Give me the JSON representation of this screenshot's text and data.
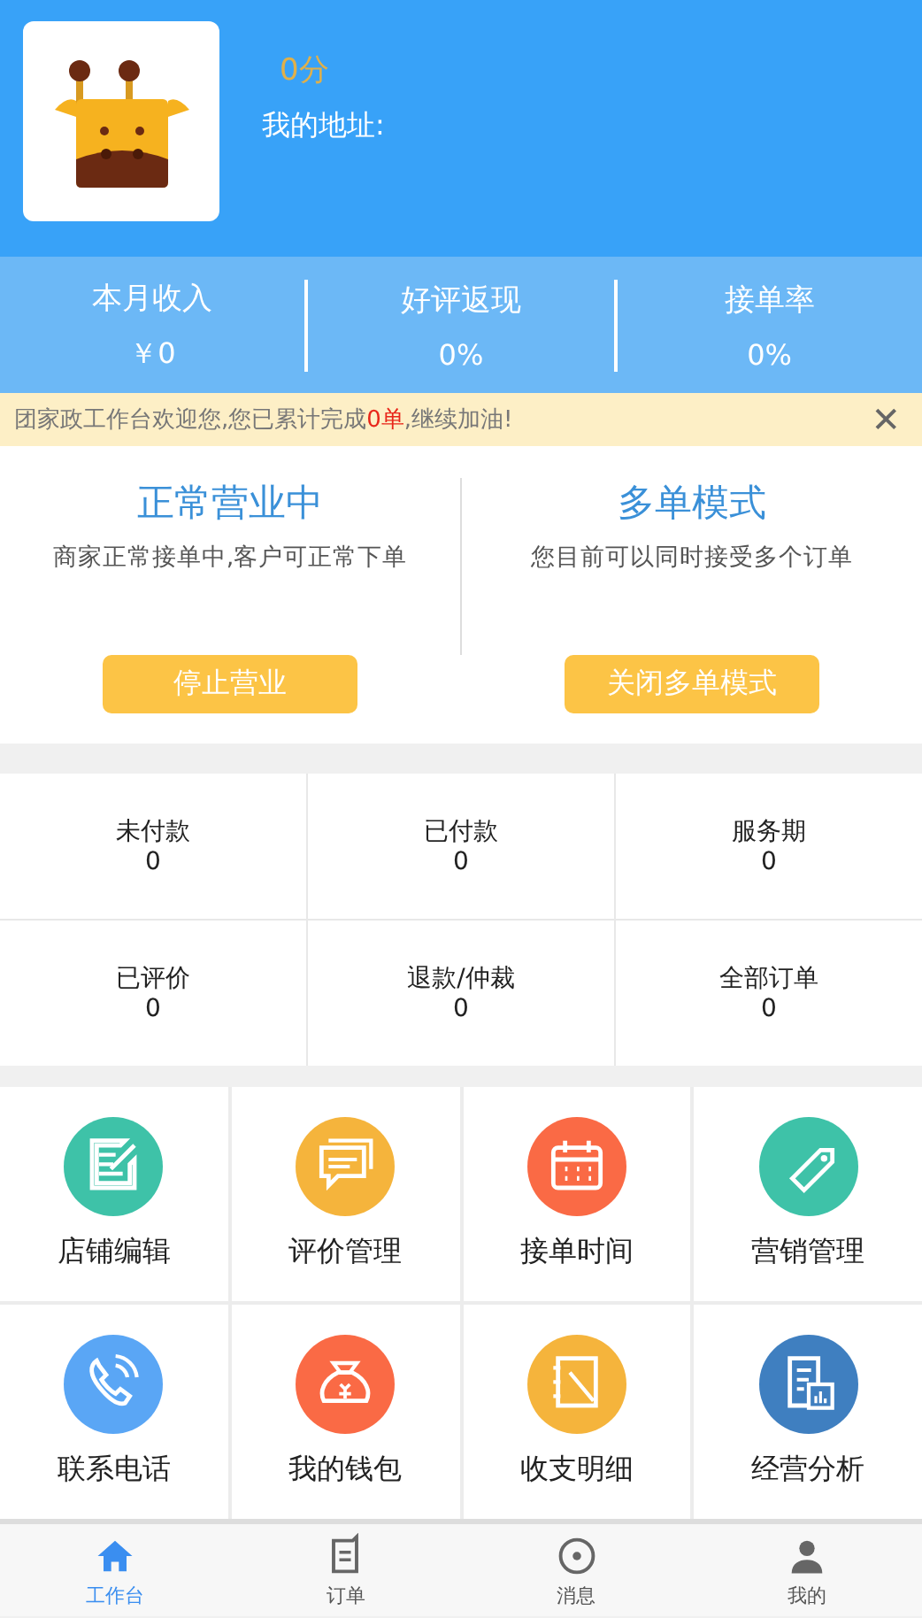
{
  "profile": {
    "score": "0分",
    "address_label": "我的地址:"
  },
  "stats": [
    {
      "label": "本月收入",
      "value": "￥0"
    },
    {
      "label": "好评返现",
      "value": "0%"
    },
    {
      "label": "接单率",
      "value": "0%"
    }
  ],
  "notice": {
    "text": "团家政工作台欢迎您,您已累计完成**0单**,继续加油!",
    "close": "✕"
  },
  "modes": [
    {
      "title": "正常营业中",
      "desc": "商家正常接单中,客户可正常下单",
      "button": "停止营业"
    },
    {
      "title": "多单模式",
      "desc": "您目前可以同时接受多个订单",
      "button": "关闭多单模式"
    }
  ],
  "orders": [
    {
      "label": "未付款",
      "count": "0"
    },
    {
      "label": "已付款",
      "count": "0"
    },
    {
      "label": "服务期",
      "count": "0"
    },
    {
      "label": "已评价",
      "count": "0"
    },
    {
      "label": "退款/仲裁",
      "count": "0"
    },
    {
      "label": "全部订单",
      "count": "0"
    }
  ],
  "features": [
    {
      "label": "店铺编辑",
      "kind": "edit",
      "color": "#3ec2a8"
    },
    {
      "label": "评价管理",
      "kind": "chat",
      "color": "#f5b43c"
    },
    {
      "label": "接单时间",
      "kind": "calendar",
      "color": "#fa6a45"
    },
    {
      "label": "营销管理",
      "kind": "tag",
      "color": "#3ec2a8"
    },
    {
      "label": "联系电话",
      "kind": "phone",
      "color": "#5aa6f5"
    },
    {
      "label": "我的钱包",
      "kind": "wallet",
      "color": "#fa6a45"
    },
    {
      "label": "收支明细",
      "kind": "notebook",
      "color": "#f5b43c"
    },
    {
      "label": "经营分析",
      "kind": "report",
      "color": "#3f7fc0"
    }
  ],
  "tabs": [
    {
      "label": "工作台",
      "kind": "home",
      "selected": true
    },
    {
      "label": "订单",
      "kind": "order",
      "selected": false
    },
    {
      "label": "消息",
      "kind": "message",
      "selected": false
    },
    {
      "label": "我的",
      "kind": "user",
      "selected": false
    }
  ]
}
